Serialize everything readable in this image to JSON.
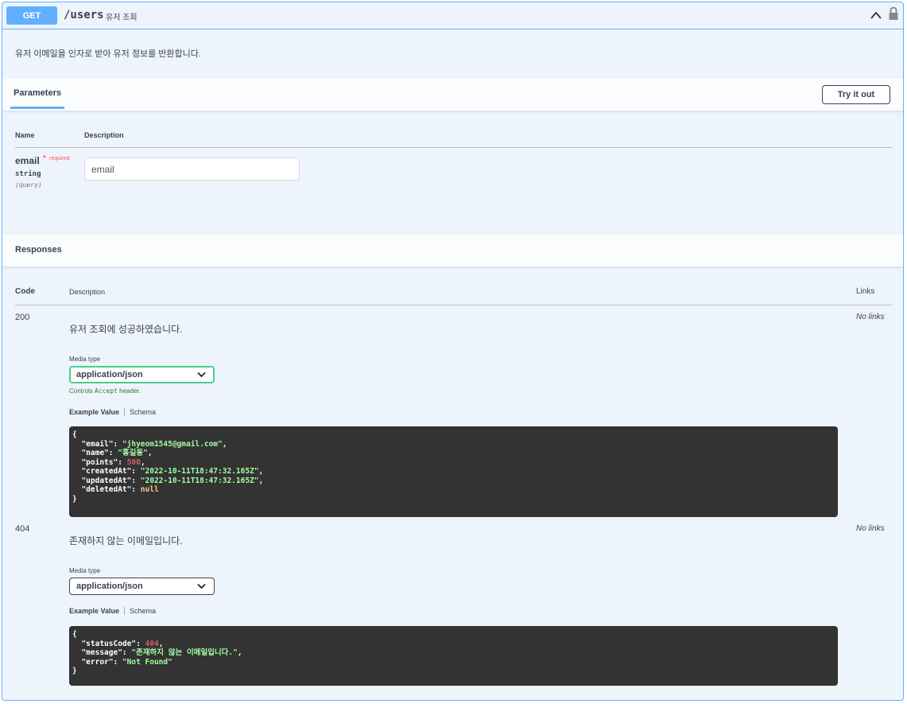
{
  "operation": {
    "method": "GET",
    "path": "/users",
    "summary": "유저 조회",
    "description": "유저 이메일을 인자로 받아 유저 정보를 반환합니다."
  },
  "parameters": {
    "tab_label": "Parameters",
    "try_button": "Try it out",
    "columns": {
      "name": "Name",
      "description": "Description"
    },
    "items": [
      {
        "name": "email",
        "required_star": "*",
        "required_label": "required",
        "type": "string",
        "in": "(query)",
        "placeholder": "email"
      }
    ]
  },
  "responses": {
    "title": "Responses",
    "columns": {
      "code": "Code",
      "description": "Description",
      "links": "Links"
    },
    "items": [
      {
        "code": "200",
        "description": "유저 조회에 성공하였습니다.",
        "links": "No links",
        "media_type_label": "Media type",
        "media_type": "application/json",
        "controls_prefix": "Controls ",
        "controls_mono": "Accept",
        "controls_suffix": " header.",
        "example_tab": "Example Value",
        "schema_tab": "Schema",
        "example_lines": [
          "{",
          "  \"email\": \"jhyeom1545@gmail.com\",",
          "  \"name\": \"홍길동\",",
          "  \"points\": 500,",
          "  \"createdAt\": \"2022-10-11T18:47:32.165Z\",",
          "  \"updatedAt\": \"2022-10-11T18:47:32.165Z\",",
          "  \"deletedAt\": null",
          "}"
        ]
      },
      {
        "code": "404",
        "description": "존재하지 않는 이메일입니다.",
        "links": "No links",
        "media_type_label": "Media type",
        "media_type": "application/json",
        "example_tab": "Example Value",
        "schema_tab": "Schema",
        "example_lines": [
          "{",
          "  \"statusCode\": 404,",
          "  \"message\": \"존재하지 않는 이메일입니다.\",",
          "  \"error\": \"Not Found\"",
          "}"
        ]
      }
    ]
  },
  "colors": {
    "get_accent": "#61affe",
    "block_bg": "#eef4fc",
    "code_bg": "#333333",
    "code_string": "#a2fca2",
    "code_number": "#d36363",
    "code_null": "#fcc28c",
    "required": "#ff2b2b"
  },
  "icons": [
    "chevron-up-icon",
    "lock-icon",
    "chevron-down-icon"
  ]
}
